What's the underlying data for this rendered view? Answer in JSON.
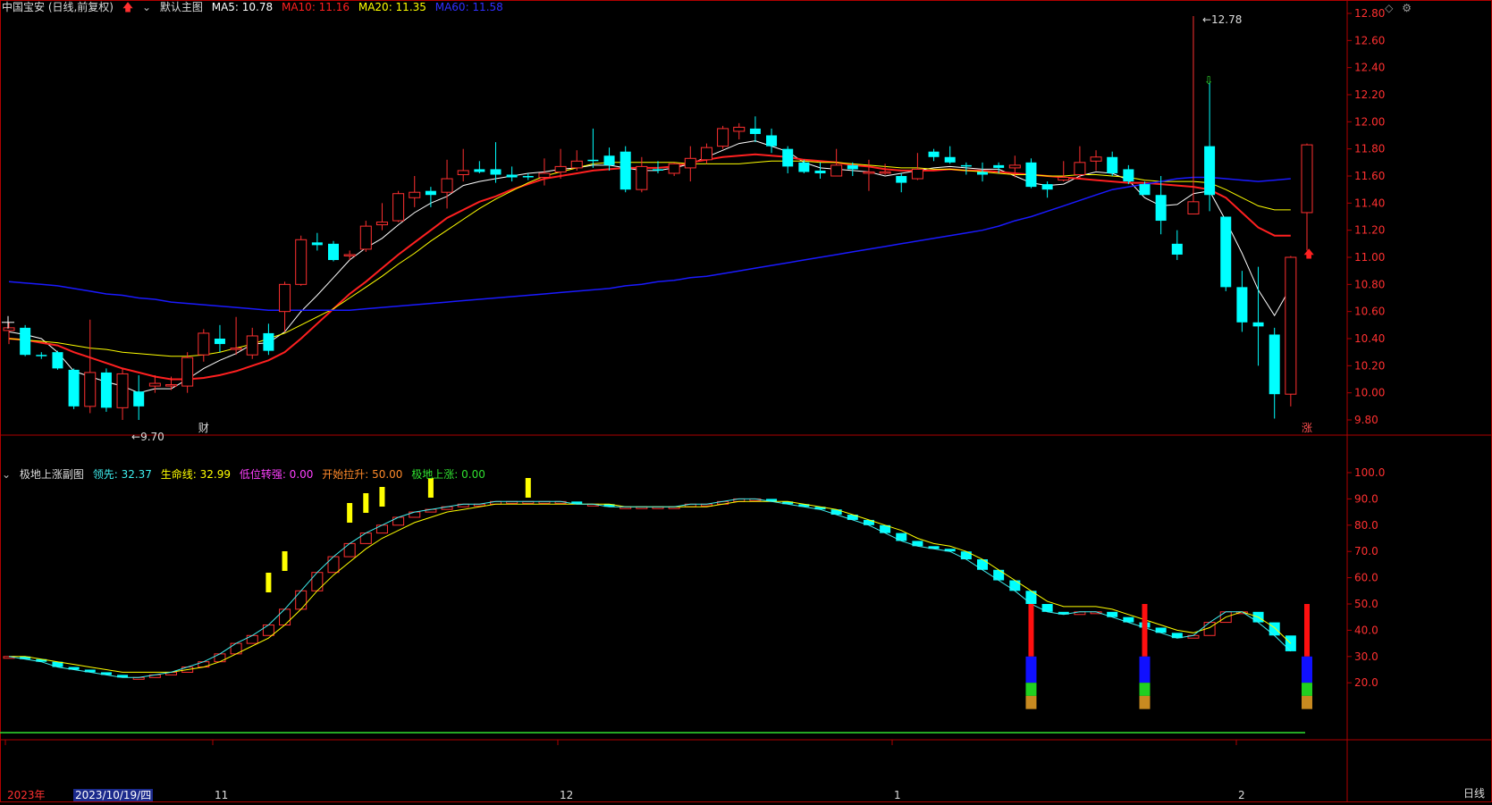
{
  "main_header": {
    "title": "中国宝安 (日线,前复权)",
    "default_chart": "默认主图",
    "ma": [
      {
        "label": "MA5: 10.78",
        "color": "#ffffff"
      },
      {
        "label": "MA10: 11.16",
        "color": "#ff2020"
      },
      {
        "label": "MA20: 11.35",
        "color": "#ffff00"
      },
      {
        "label": "MA60: 11.58",
        "color": "#2020ff"
      }
    ]
  },
  "sub_header": {
    "title": "极地上涨副图",
    "lines": [
      {
        "label": "领先: 32.37",
        "color": "#3ff0f0"
      },
      {
        "label": "生命线: 32.99",
        "color": "#ffff00"
      },
      {
        "label": "低位转强: 0.00",
        "color": "#ff40ff"
      },
      {
        "label": "开始拉升: 50.00",
        "color": "#ff8a2a"
      },
      {
        "label": "极地上涨: 0.00",
        "color": "#30e030"
      }
    ]
  },
  "period_label": "日线",
  "cursor_date": "2023/10/19/四",
  "colors": {
    "up": "#ff3030",
    "down": "#00ffff",
    "ma5": "#ffffff",
    "ma10": "#ff2020",
    "ma20": "#ffff00",
    "ma60": "#1a1aff",
    "axis": "#b00000",
    "axis_text": "#ff3030"
  },
  "chart_data": [
    {
      "type": "candlestick",
      "title": "中国宝安 (日线,前复权)",
      "ylim": [
        9.6,
        12.85
      ],
      "yticks": [
        "12.80",
        "12.60",
        "12.40",
        "12.20",
        "12.00",
        "11.80",
        "11.60",
        "11.40",
        "11.20",
        "11.00",
        "10.80",
        "10.60",
        "10.40",
        "10.20",
        "10.00",
        "9.80"
      ],
      "xticks": [
        "2023年",
        "11",
        "12",
        "1",
        "2"
      ],
      "annotations": [
        {
          "text": "12.78",
          "x_index": 73,
          "y": 12.78
        },
        {
          "text": "9.70",
          "x_index": 7,
          "y": 9.7
        },
        {
          "text": "财",
          "x_index": 12
        },
        {
          "text": "涨",
          "x_index": 80
        }
      ],
      "candles": [
        [
          10.46,
          10.48,
          10.52,
          10.36
        ],
        [
          10.48,
          10.28,
          10.5,
          10.27
        ],
        [
          10.28,
          10.27,
          10.3,
          10.25
        ],
        [
          10.3,
          10.18,
          10.31,
          10.17
        ],
        [
          10.17,
          9.9,
          10.18,
          9.88
        ],
        [
          9.9,
          10.15,
          10.54,
          9.85
        ],
        [
          10.15,
          9.89,
          10.18,
          9.86
        ],
        [
          9.89,
          10.14,
          10.18,
          9.8
        ],
        [
          10.01,
          9.9,
          10.13,
          9.8
        ],
        [
          10.05,
          10.07,
          10.13,
          10.0
        ],
        [
          10.06,
          10.06,
          10.12,
          10.02
        ],
        [
          10.05,
          10.26,
          10.3,
          10.0
        ],
        [
          10.28,
          10.44,
          10.47,
          10.23
        ],
        [
          10.4,
          10.36,
          10.5,
          10.3
        ],
        [
          10.32,
          10.33,
          10.56,
          10.28
        ],
        [
          10.28,
          10.42,
          10.48,
          10.25
        ],
        [
          10.44,
          10.31,
          10.51,
          10.28
        ],
        [
          10.6,
          10.8,
          10.82,
          10.45
        ],
        [
          10.8,
          11.13,
          11.16,
          10.79
        ],
        [
          11.11,
          11.09,
          11.18,
          11.05
        ],
        [
          11.1,
          10.98,
          11.12,
          10.97
        ],
        [
          11.02,
          11.02,
          11.05,
          10.98
        ],
        [
          11.06,
          11.23,
          11.27,
          11.04
        ],
        [
          11.24,
          11.26,
          11.4,
          11.2
        ],
        [
          11.27,
          11.47,
          11.49,
          11.26
        ],
        [
          11.44,
          11.48,
          11.6,
          11.37
        ],
        [
          11.49,
          11.46,
          11.52,
          11.37
        ],
        [
          11.48,
          11.58,
          11.72,
          11.36
        ],
        [
          11.61,
          11.64,
          11.8,
          11.56
        ],
        [
          11.65,
          11.63,
          11.71,
          11.62
        ],
        [
          11.65,
          11.61,
          11.85,
          11.55
        ],
        [
          11.61,
          11.59,
          11.67,
          11.56
        ],
        [
          11.6,
          11.59,
          11.62,
          11.57
        ],
        [
          11.59,
          11.62,
          11.73,
          11.53
        ],
        [
          11.63,
          11.67,
          11.8,
          11.58
        ],
        [
          11.66,
          11.71,
          11.79,
          11.64
        ],
        [
          11.72,
          11.71,
          11.95,
          11.66
        ],
        [
          11.75,
          11.68,
          11.81,
          11.64
        ],
        [
          11.78,
          11.5,
          11.82,
          11.48
        ],
        [
          11.5,
          11.67,
          11.74,
          11.48
        ],
        [
          11.65,
          11.64,
          11.71,
          11.62
        ],
        [
          11.62,
          11.69,
          11.7,
          11.6
        ],
        [
          11.66,
          11.73,
          11.82,
          11.56
        ],
        [
          11.72,
          11.81,
          11.84,
          11.69
        ],
        [
          11.82,
          11.95,
          11.97,
          11.8
        ],
        [
          11.93,
          11.96,
          11.99,
          11.87
        ],
        [
          11.95,
          11.91,
          12.04,
          11.85
        ],
        [
          11.9,
          11.82,
          11.95,
          11.77
        ],
        [
          11.8,
          11.67,
          11.82,
          11.62
        ],
        [
          11.7,
          11.63,
          11.72,
          11.62
        ],
        [
          11.64,
          11.62,
          11.7,
          11.58
        ],
        [
          11.6,
          11.68,
          11.8,
          11.6
        ],
        [
          11.68,
          11.65,
          11.7,
          11.6
        ],
        [
          11.63,
          11.63,
          11.72,
          11.49
        ],
        [
          11.62,
          11.63,
          11.69,
          11.61
        ],
        [
          11.6,
          11.55,
          11.62,
          11.48
        ],
        [
          11.58,
          11.65,
          11.77,
          11.57
        ],
        [
          11.78,
          11.74,
          11.8,
          11.71
        ],
        [
          11.74,
          11.7,
          11.82,
          11.69
        ],
        [
          11.68,
          11.67,
          11.7,
          11.61
        ],
        [
          11.63,
          11.61,
          11.7,
          11.56
        ],
        [
          11.68,
          11.66,
          11.7,
          11.62
        ],
        [
          11.66,
          11.68,
          11.75,
          11.59
        ],
        [
          11.7,
          11.52,
          11.73,
          11.51
        ],
        [
          11.54,
          11.5,
          11.56,
          11.44
        ],
        [
          11.57,
          11.59,
          11.71,
          11.56
        ],
        [
          11.61,
          11.7,
          11.82,
          11.58
        ],
        [
          11.71,
          11.74,
          11.79,
          11.64
        ],
        [
          11.74,
          11.62,
          11.78,
          11.6
        ],
        [
          11.65,
          11.56,
          11.68,
          11.54
        ],
        [
          11.54,
          11.46,
          11.56,
          11.5
        ],
        [
          11.46,
          11.27,
          11.6,
          11.17
        ],
        [
          11.1,
          11.02,
          11.2,
          10.98
        ],
        [
          11.32,
          11.41,
          12.78,
          11.4
        ],
        [
          11.82,
          11.46,
          12.29,
          11.34
        ],
        [
          11.3,
          10.78,
          11.3,
          10.75
        ],
        [
          10.78,
          10.52,
          10.9,
          10.45
        ],
        [
          10.52,
          10.49,
          10.93,
          10.2
        ],
        [
          10.43,
          9.99,
          10.48,
          9.81
        ],
        [
          9.99,
          11.0,
          11.01,
          9.9
        ],
        [
          11.33,
          11.83,
          11.84,
          11.05
        ]
      ],
      "series": [
        {
          "name": "MA5",
          "values": [
            10.45,
            10.43,
            10.4,
            10.3,
            10.16,
            10.12,
            10.08,
            10.05,
            10.0,
            10.03,
            10.03,
            10.1,
            10.18,
            10.24,
            10.29,
            10.36,
            10.37,
            10.45,
            10.6,
            10.72,
            10.85,
            10.98,
            11.07,
            11.14,
            11.24,
            11.33,
            11.4,
            11.45,
            11.53,
            11.56,
            11.58,
            11.6,
            11.62,
            11.63,
            11.65,
            11.66,
            11.68,
            11.68,
            11.66,
            11.64,
            11.64,
            11.66,
            11.69,
            11.74,
            11.79,
            11.84,
            11.86,
            11.82,
            11.78,
            11.7,
            11.66,
            11.65,
            11.64,
            11.63,
            11.6,
            11.62,
            11.64,
            11.66,
            11.67,
            11.66,
            11.65,
            11.65,
            11.6,
            11.55,
            11.53,
            11.54,
            11.6,
            11.63,
            11.62,
            11.57,
            11.44,
            11.38,
            11.39,
            11.47,
            11.49,
            11.27,
            11.03,
            10.76,
            10.57,
            10.78
          ]
        },
        {
          "name": "MA10",
          "values": [
            10.4,
            10.39,
            10.37,
            10.35,
            10.3,
            10.26,
            10.22,
            10.18,
            10.15,
            10.12,
            10.1,
            10.1,
            10.11,
            10.13,
            10.16,
            10.2,
            10.24,
            10.3,
            10.4,
            10.51,
            10.62,
            10.73,
            10.82,
            10.92,
            11.02,
            11.11,
            11.2,
            11.29,
            11.35,
            11.41,
            11.45,
            11.5,
            11.54,
            11.58,
            11.6,
            11.62,
            11.64,
            11.65,
            11.66,
            11.66,
            11.66,
            11.67,
            11.7,
            11.72,
            11.74,
            11.75,
            11.76,
            11.75,
            11.74,
            11.72,
            11.71,
            11.7,
            11.68,
            11.67,
            11.65,
            11.64,
            11.64,
            11.64,
            11.65,
            11.64,
            11.64,
            11.63,
            11.62,
            11.61,
            11.6,
            11.59,
            11.58,
            11.57,
            11.56,
            11.55,
            11.55,
            11.54,
            11.53,
            11.52,
            11.5,
            11.44,
            11.33,
            11.22,
            11.16,
            11.16
          ]
        },
        {
          "name": "MA20",
          "values": [
            10.4,
            10.39,
            10.38,
            10.37,
            10.35,
            10.33,
            10.32,
            10.3,
            10.29,
            10.28,
            10.27,
            10.27,
            10.28,
            10.3,
            10.33,
            10.36,
            10.4,
            10.44,
            10.5,
            10.56,
            10.62,
            10.7,
            10.78,
            10.86,
            10.95,
            11.03,
            11.12,
            11.2,
            11.28,
            11.36,
            11.43,
            11.49,
            11.55,
            11.6,
            11.63,
            11.66,
            11.69,
            11.7,
            11.7,
            11.7,
            11.7,
            11.7,
            11.69,
            11.69,
            11.69,
            11.69,
            11.7,
            11.71,
            11.71,
            11.71,
            11.7,
            11.7,
            11.69,
            11.68,
            11.67,
            11.66,
            11.66,
            11.65,
            11.65,
            11.64,
            11.63,
            11.62,
            11.61,
            11.61,
            11.6,
            11.6,
            11.61,
            11.61,
            11.6,
            11.59,
            11.57,
            11.56,
            11.56,
            11.56,
            11.55,
            11.5,
            11.44,
            11.38,
            11.35,
            11.35
          ]
        },
        {
          "name": "MA60",
          "values": [
            10.82,
            10.81,
            10.8,
            10.79,
            10.77,
            10.75,
            10.73,
            10.72,
            10.7,
            10.69,
            10.67,
            10.66,
            10.65,
            10.64,
            10.63,
            10.62,
            10.61,
            10.61,
            10.61,
            10.61,
            10.61,
            10.61,
            10.62,
            10.63,
            10.64,
            10.65,
            10.66,
            10.67,
            10.68,
            10.69,
            10.7,
            10.71,
            10.72,
            10.73,
            10.74,
            10.75,
            10.76,
            10.77,
            10.79,
            10.8,
            10.82,
            10.83,
            10.85,
            10.86,
            10.88,
            10.9,
            10.92,
            10.94,
            10.96,
            10.98,
            11.0,
            11.02,
            11.04,
            11.06,
            11.08,
            11.1,
            11.12,
            11.14,
            11.16,
            11.18,
            11.2,
            11.23,
            11.27,
            11.3,
            11.34,
            11.38,
            11.42,
            11.46,
            11.5,
            11.52,
            11.54,
            11.56,
            11.58,
            11.59,
            11.59,
            11.58,
            11.57,
            11.56,
            11.57,
            11.58
          ]
        }
      ]
    },
    {
      "type": "bar",
      "title": "极地上涨副图",
      "ylim": [
        0,
        105
      ],
      "yticks": [
        "100.0",
        "90.0",
        "80.0",
        "70.0",
        "60.0",
        "50.0",
        "40.0",
        "30.0",
        "20.0"
      ],
      "series": [
        {
          "name": "领先",
          "values": [
            30,
            29,
            28,
            26,
            25,
            24,
            23,
            22,
            22,
            23,
            24,
            26,
            28,
            31,
            35,
            38,
            42,
            48,
            55,
            62,
            68,
            73,
            77,
            80,
            83,
            85,
            86,
            87,
            88,
            88,
            89,
            89,
            89,
            89,
            89,
            88,
            88,
            87,
            87,
            87,
            87,
            87,
            88,
            88,
            89,
            90,
            90,
            89,
            88,
            87,
            86,
            84,
            82,
            80,
            77,
            74,
            72,
            71,
            70,
            67,
            63,
            59,
            55,
            50,
            47,
            46,
            47,
            47,
            45,
            43,
            41,
            39,
            37,
            38,
            43,
            47,
            47,
            43,
            38,
            32
          ]
        },
        {
          "name": "生命线",
          "values": [
            30,
            30,
            29,
            28,
            27,
            26,
            25,
            24,
            24,
            24,
            24,
            25,
            26,
            28,
            31,
            34,
            37,
            42,
            48,
            55,
            61,
            66,
            71,
            75,
            78,
            81,
            83,
            85,
            86,
            87,
            88,
            88,
            88,
            88,
            88,
            88,
            88,
            88,
            87,
            87,
            87,
            87,
            87,
            87,
            88,
            89,
            89,
            89,
            89,
            88,
            87,
            86,
            84,
            82,
            80,
            78,
            75,
            73,
            72,
            70,
            67,
            63,
            59,
            55,
            51,
            49,
            49,
            49,
            48,
            46,
            44,
            42,
            40,
            39,
            41,
            45,
            47,
            45,
            41,
            35
          ]
        }
      ]
    }
  ]
}
